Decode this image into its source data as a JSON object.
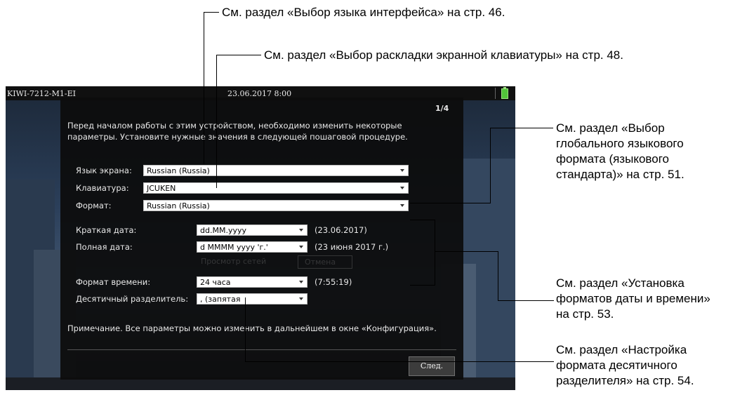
{
  "device": {
    "title": "KIWI-7212-M1-EI",
    "datetime": "23.06.2017 8:00"
  },
  "dialog": {
    "page_indicator": "1/4",
    "intro_line1": "Перед началом работы с этим устройством, необходимо изменить некоторые",
    "intro_line2": "параметры.  Установите нужные значения в следующей пошаговой процедуре.",
    "screen_language_label": "Язык экрана:",
    "screen_language_value": "Russian (Russia)",
    "keyboard_label": "Клавиатура:",
    "keyboard_value": "JCUKEN",
    "format_label": "Формат:",
    "format_value": "Russian (Russia)",
    "short_date_label": "Краткая дата:",
    "short_date_value": "dd.MM.yyyy",
    "short_date_example": "(23.06.2017)",
    "long_date_label": "Полная дата:",
    "long_date_value": "d MMMM yyyy 'г.'",
    "long_date_example": "(23 июня 2017 г.)",
    "time_format_label": "Формат времени:",
    "time_format_value": "24 часа",
    "time_format_example": "(7:55:19)",
    "decimal_label": "Десятичный разделитель:",
    "decimal_value": ", (запятая",
    "note": "Примечание. Все параметры можно изменить в дальнейшем в окне «Конфигурация».",
    "next_button": "След."
  },
  "callouts": {
    "ui_language": "См. раздел «Выбор языка интерфейса» на стр. 46.",
    "keyboard_layout": "См. раздел «Выбор раскладки экранной клавиатуры» на стр. 48.",
    "global_format": [
      "См. раздел «Выбор",
      "глобального языкового",
      "формата (языкового",
      "стандарта)» на стр. 51."
    ],
    "date_time_formats": [
      "См. раздел «Установка",
      "форматов даты и времени»",
      "на стр. 53."
    ],
    "decimal_separator": [
      "См. раздел «Настройка",
      "формата десятичного",
      "разделителя» на стр. 54."
    ]
  },
  "colors": {
    "dialog_bg": "#0c0c0c",
    "battery": "#52c43a"
  }
}
